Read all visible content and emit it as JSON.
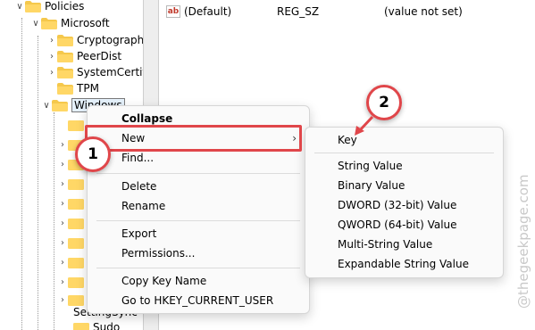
{
  "tree": {
    "nodes": [
      {
        "label": "Policies",
        "expanded": true
      },
      {
        "label": "Microsoft",
        "expanded": true
      },
      {
        "label": "Cryptography",
        "expanded": false
      },
      {
        "label": "PeerDist",
        "expanded": false
      },
      {
        "label": "SystemCertific",
        "expanded": false
      },
      {
        "label": "TPM",
        "expanded": false
      },
      {
        "label": "Windows",
        "expanded": true
      },
      {
        "label": "SettingSync",
        "expanded": false
      },
      {
        "label": "Sudo",
        "expanded": false
      }
    ]
  },
  "values": {
    "row": {
      "name": "(Default)",
      "type": "REG_SZ",
      "data": "(value not set)",
      "icon": "string-value-icon"
    }
  },
  "context_menu": {
    "items": [
      "Collapse",
      "New",
      "Find...",
      "Delete",
      "Rename",
      "Export",
      "Permissions...",
      "Copy Key Name",
      "Go to HKEY_CURRENT_USER"
    ]
  },
  "submenu": {
    "items": [
      "Key",
      "String Value",
      "Binary Value",
      "DWORD (32-bit) Value",
      "QWORD (64-bit) Value",
      "Multi-String Value",
      "Expandable String Value"
    ]
  },
  "annotations": {
    "step1": "1",
    "step2": "2",
    "color": "#e0464a"
  },
  "watermark": "@thegeekpage.com"
}
